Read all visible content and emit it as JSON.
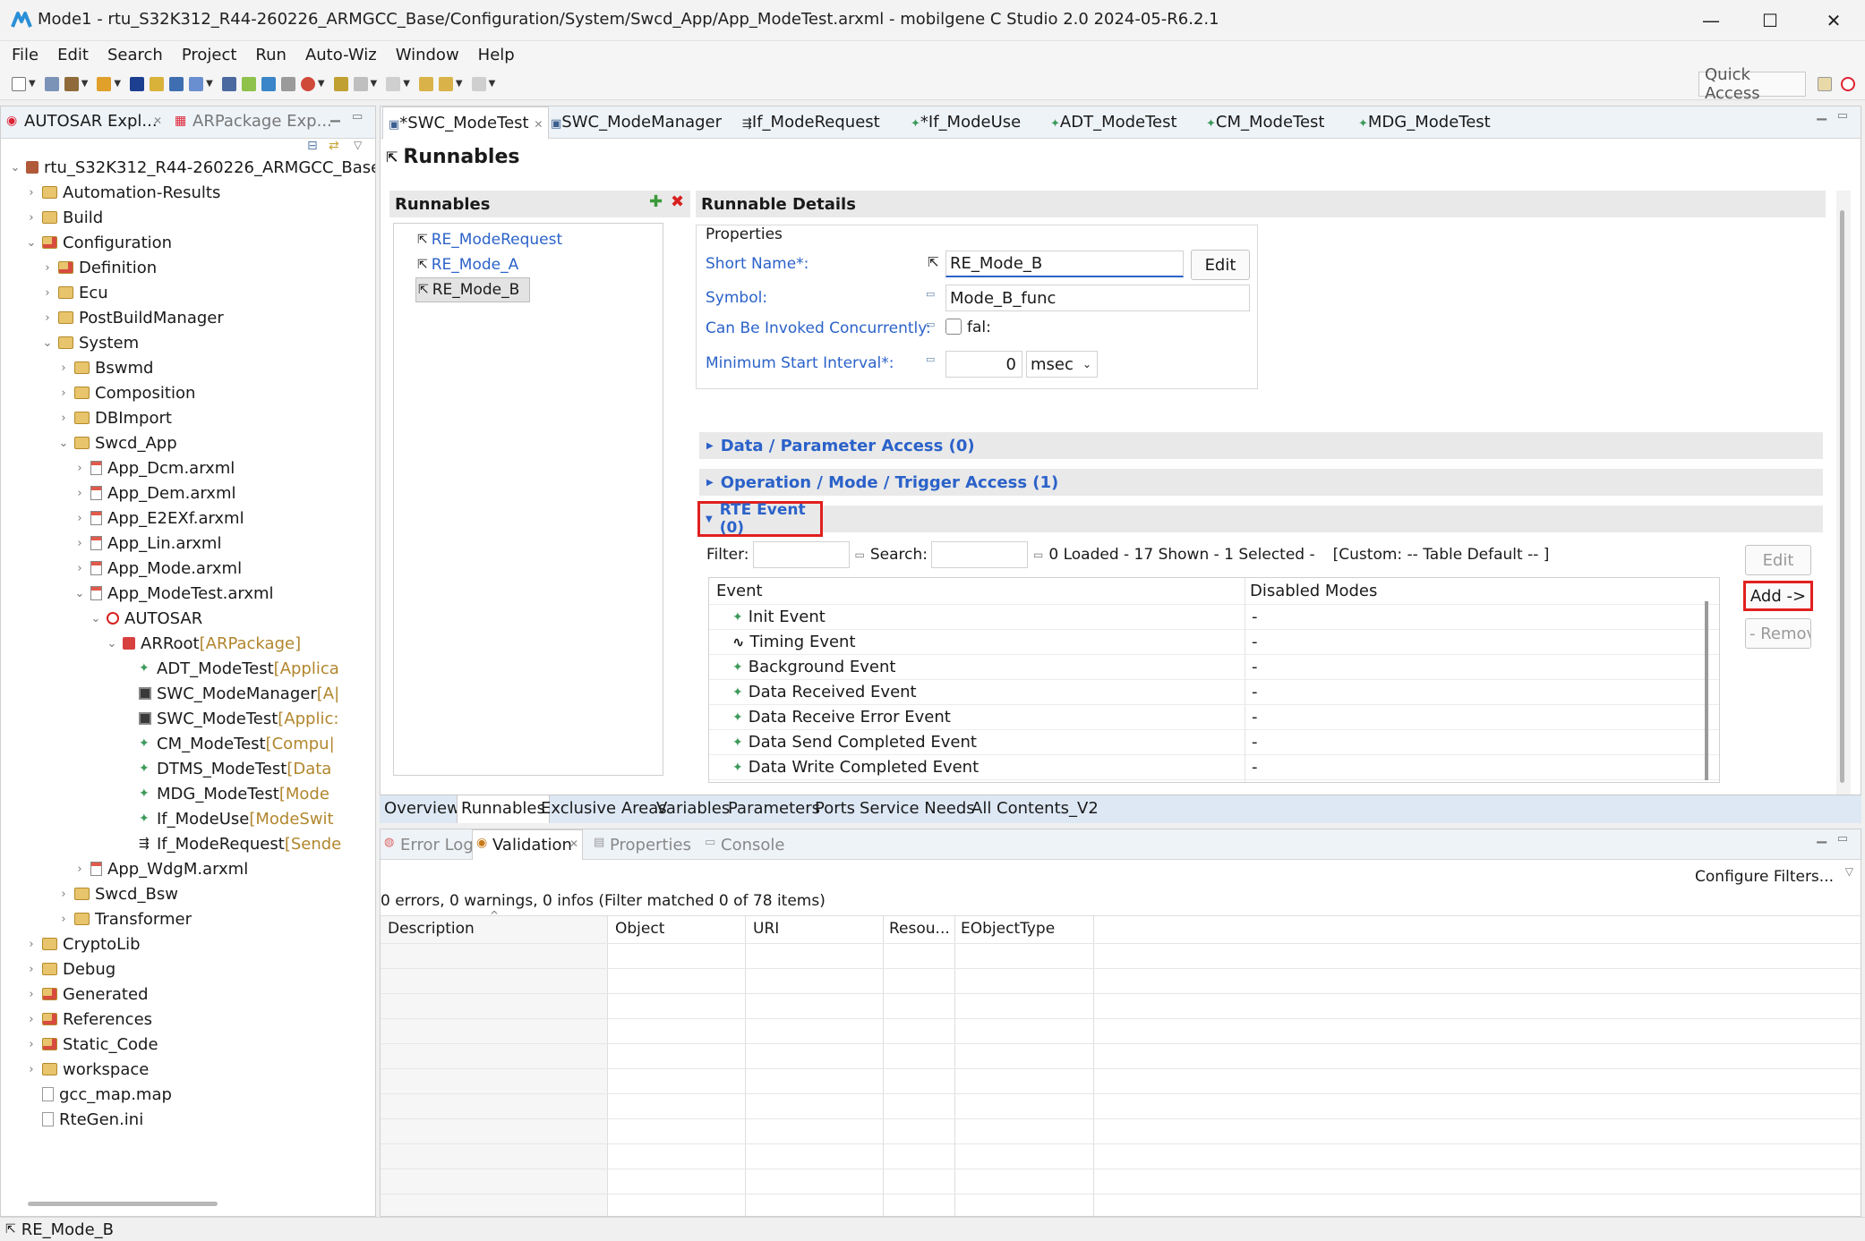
{
  "window": {
    "title": "Mode1 - rtu_S32K312_R44-260226_ARMGCC_Base/Configuration/System/Swcd_App/App_ModeTest.arxml - mobilgene C Studio 2.0 2024-05-R6.2.1",
    "minimize": "—",
    "maximize": "☐",
    "close": "✕"
  },
  "menu": [
    "File",
    "Edit",
    "Search",
    "Project",
    "Run",
    "Auto-Wiz",
    "Window",
    "Help"
  ],
  "toolbar": {
    "quick_access": "Quick Access"
  },
  "left_tabs": [
    {
      "label": "AUTOSAR Expl..."
    },
    {
      "label": "ARPackage Exp..."
    }
  ],
  "tree": [
    {
      "label": "rtu_S32K312_R44-260226_ARMGCC_Base",
      "suffix": "",
      "level": 0,
      "icon": "project",
      "twisty": "down"
    },
    {
      "label": "Automation-Results",
      "suffix": "",
      "level": 1,
      "icon": "folder",
      "twisty": "right"
    },
    {
      "label": "Build",
      "suffix": "",
      "level": 1,
      "icon": "folder",
      "twisty": "right"
    },
    {
      "label": "Configuration",
      "suffix": "",
      "level": 1,
      "icon": "folder-red",
      "twisty": "down"
    },
    {
      "label": "Definition",
      "suffix": "",
      "level": 2,
      "icon": "folder-red",
      "twisty": "right"
    },
    {
      "label": "Ecu",
      "suffix": "",
      "level": 2,
      "icon": "folder",
      "twisty": "right"
    },
    {
      "label": "PostBuildManager",
      "suffix": "",
      "level": 2,
      "icon": "folder",
      "twisty": "right"
    },
    {
      "label": "System",
      "suffix": "",
      "level": 2,
      "icon": "folder",
      "twisty": "down"
    },
    {
      "label": "Bswmd",
      "suffix": "",
      "level": 3,
      "icon": "folder",
      "twisty": "right"
    },
    {
      "label": "Composition",
      "suffix": "",
      "level": 3,
      "icon": "folder",
      "twisty": "right"
    },
    {
      "label": "DBImport",
      "suffix": "",
      "level": 3,
      "icon": "folder",
      "twisty": "right"
    },
    {
      "label": "Swcd_App",
      "suffix": "",
      "level": 3,
      "icon": "folder",
      "twisty": "down"
    },
    {
      "label": "App_Dcm.arxml",
      "suffix": "",
      "level": 4,
      "icon": "file",
      "twisty": "right"
    },
    {
      "label": "App_Dem.arxml",
      "suffix": "",
      "level": 4,
      "icon": "file",
      "twisty": "right"
    },
    {
      "label": "App_E2EXf.arxml",
      "suffix": "",
      "level": 4,
      "icon": "file",
      "twisty": "right"
    },
    {
      "label": "App_Lin.arxml",
      "suffix": "",
      "level": 4,
      "icon": "file",
      "twisty": "right"
    },
    {
      "label": "App_Mode.arxml",
      "suffix": "",
      "level": 4,
      "icon": "file",
      "twisty": "right"
    },
    {
      "label": "App_ModeTest.arxml",
      "suffix": "",
      "level": 4,
      "icon": "file",
      "twisty": "down"
    },
    {
      "label": "AUTOSAR",
      "suffix": "",
      "level": 5,
      "icon": "autosar",
      "twisty": "down"
    },
    {
      "label": "ARRoot",
      "suffix": " [ARPackage]",
      "level": 6,
      "icon": "package",
      "twisty": "down"
    },
    {
      "label": "ADT_ModeTest",
      "suffix": " [Applica",
      "level": 7,
      "icon": "adt",
      "twisty": ""
    },
    {
      "label": "SWC_ModeManager",
      "suffix": " [A|",
      "level": 7,
      "icon": "swc",
      "twisty": ""
    },
    {
      "label": "SWC_ModeTest",
      "suffix": " [Applic:",
      "level": 7,
      "icon": "swc",
      "twisty": ""
    },
    {
      "label": "CM_ModeTest",
      "suffix": " [Compu|",
      "level": 7,
      "icon": "adt",
      "twisty": ""
    },
    {
      "label": "DTMS_ModeTest",
      "suffix": " [Data",
      "level": 7,
      "icon": "adt",
      "twisty": ""
    },
    {
      "label": "MDG_ModeTest",
      "suffix": " [Mode",
      "level": 7,
      "icon": "adt",
      "twisty": ""
    },
    {
      "label": "If_ModeUse",
      "suffix": " [ModeSwit",
      "level": 7,
      "icon": "adt",
      "twisty": ""
    },
    {
      "label": "If_ModeRequest",
      "suffix": " [Sende",
      "level": 7,
      "icon": "if",
      "twisty": ""
    },
    {
      "label": "App_WdgM.arxml",
      "suffix": "",
      "level": 4,
      "icon": "file",
      "twisty": "right"
    },
    {
      "label": "Swcd_Bsw",
      "suffix": "",
      "level": 3,
      "icon": "folder",
      "twisty": "right"
    },
    {
      "label": "Transformer",
      "suffix": "",
      "level": 3,
      "icon": "folder",
      "twisty": "right"
    },
    {
      "label": "CryptoLib",
      "suffix": "",
      "level": 1,
      "icon": "folder",
      "twisty": "right"
    },
    {
      "label": "Debug",
      "suffix": "",
      "level": 1,
      "icon": "folder",
      "twisty": "right"
    },
    {
      "label": "Generated",
      "suffix": "",
      "level": 1,
      "icon": "folder-red",
      "twisty": "right"
    },
    {
      "label": "References",
      "suffix": "",
      "level": 1,
      "icon": "folder-red",
      "twisty": "right"
    },
    {
      "label": "Static_Code",
      "suffix": "",
      "level": 1,
      "icon": "folder-red",
      "twisty": "right"
    },
    {
      "label": "workspace",
      "suffix": "",
      "level": 1,
      "icon": "folder",
      "twisty": "right"
    },
    {
      "label": "gcc_map.map",
      "suffix": "",
      "level": 1,
      "icon": "plain",
      "twisty": ""
    },
    {
      "label": "RteGen.ini",
      "suffix": "",
      "level": 1,
      "icon": "plain",
      "twisty": ""
    }
  ],
  "editor_tabs": [
    {
      "label": "*SWC_ModeTest",
      "active": true
    },
    {
      "label": "SWC_ModeManager",
      "active": false
    },
    {
      "label": "If_ModeRequest",
      "active": false
    },
    {
      "label": "*If_ModeUse",
      "active": false
    },
    {
      "label": "ADT_ModeTest",
      "active": false
    },
    {
      "label": "CM_ModeTest",
      "active": false
    },
    {
      "label": "MDG_ModeTest",
      "active": false
    }
  ],
  "page": {
    "title": "Runnables"
  },
  "runnables": {
    "header": "Runnables",
    "items": [
      "RE_ModeRequest",
      "RE_Mode_A",
      "RE_Mode_B"
    ],
    "selected": "RE_Mode_B"
  },
  "details": {
    "header": "Runnable Details",
    "properties_label": "Properties",
    "short_name_label": "Short Name*:",
    "short_name_value": "RE_Mode_B",
    "edit_label": "Edit",
    "symbol_label": "Symbol:",
    "symbol_value": "Mode_B_func",
    "concurrent_label": "Can Be Invoked Concurrently:",
    "concurrent_value": "fal:",
    "min_interval_label": "Minimum Start Interval*:",
    "min_interval_value": "0",
    "min_interval_unit": "msec"
  },
  "sections": {
    "data_access": "Data / Parameter Access (0)",
    "operation_access": "Operation / Mode / Trigger Access (1)",
    "rte_event": "RTE Event (0)"
  },
  "event_table": {
    "filter_label": "Filter:",
    "search_label": "Search:",
    "status": "0 Loaded - 17 Shown - 1 Selected -",
    "custom": "[Custom: -- Table Default -- ]",
    "col_event": "Event",
    "col_disabled": "Disabled Modes",
    "rows": [
      {
        "event": "Init Event",
        "disabled": "-",
        "icon": "diamond"
      },
      {
        "event": "Timing Event",
        "disabled": "-",
        "icon": "wave"
      },
      {
        "event": "Background Event",
        "disabled": "-",
        "icon": "diamond"
      },
      {
        "event": "Data Received Event",
        "disabled": "-",
        "icon": "diamond"
      },
      {
        "event": "Data Receive Error Event",
        "disabled": "-",
        "icon": "diamond"
      },
      {
        "event": "Data Send Completed Event",
        "disabled": "-",
        "icon": "diamond"
      },
      {
        "event": "Data Write Completed Event",
        "disabled": "-",
        "icon": "diamond"
      }
    ],
    "edit_btn": "Edit",
    "add_btn": "Add ->",
    "remove_btn": "- Remov"
  },
  "bottom_tabs": [
    "Overview",
    "Runnables",
    "Exclusive Areas",
    "Variables",
    "Parameters",
    "Ports",
    "Service Needs",
    "All Contents_V2"
  ],
  "lower_tabs": [
    {
      "label": "Error Log"
    },
    {
      "label": "Validation"
    },
    {
      "label": "Properties"
    },
    {
      "label": "Console"
    }
  ],
  "validation": {
    "summary": "0 errors, 0 warnings, 0 infos (Filter matched 0 of 78 items)",
    "configure": "Configure Filters...",
    "columns": [
      "Description",
      "Object",
      "URI",
      "Resou...",
      "EObjectType"
    ]
  },
  "status": {
    "text": "RE_Mode_B"
  },
  "colors": {
    "accent_red": "#e0201e",
    "link_blue": "#2b62c9",
    "tab_bar": "#eef3f8"
  }
}
